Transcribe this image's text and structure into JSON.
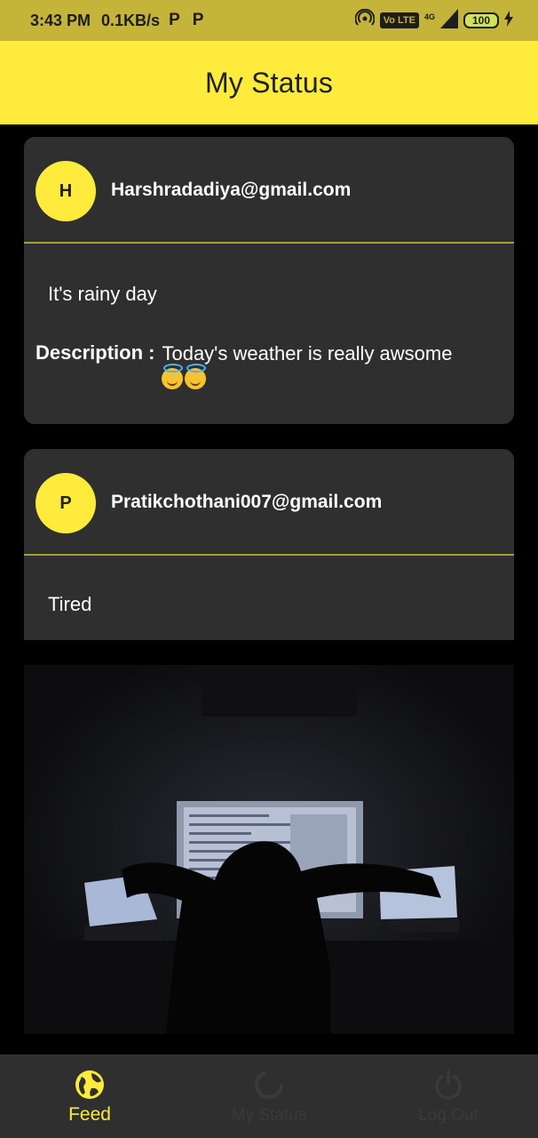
{
  "status_bar": {
    "time": "3:43 PM",
    "net_speed": "0.1KB/s",
    "notif_icons": [
      "P",
      "P"
    ],
    "volte": "Vo LTE",
    "network": "4G",
    "battery": "100"
  },
  "app_bar": {
    "title": "My Status"
  },
  "feed": [
    {
      "avatar_letter": "H",
      "email": "Harshradadiya@gmail.com",
      "status": "It's rainy day",
      "description_label": "Description :",
      "description": "Today's weather is really awsome"
    },
    {
      "avatar_letter": "P",
      "email": "Pratikchothani007@gmail.com",
      "status": "Tired"
    }
  ],
  "bottom_nav": [
    {
      "label": "Feed",
      "icon": "globe-icon",
      "active": true
    },
    {
      "label": "My Status",
      "icon": "circle-progress-icon",
      "active": false
    },
    {
      "label": "Log Out",
      "icon": "power-icon",
      "active": false
    }
  ],
  "colors": {
    "accent": "#ffeb3b",
    "status_bar": "#c4b43a",
    "card": "#2f2f2f",
    "divider": "#a79c3b",
    "background": "#000000"
  }
}
